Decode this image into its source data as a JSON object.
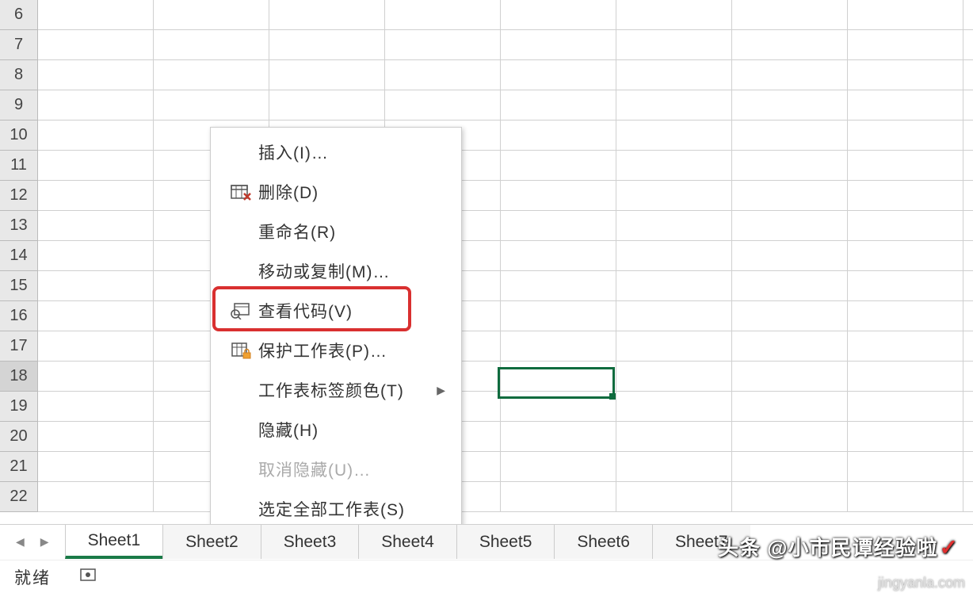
{
  "rows": [
    "6",
    "7",
    "8",
    "9",
    "10",
    "11",
    "12",
    "13",
    "14",
    "15",
    "16",
    "17",
    "18",
    "19",
    "20",
    "21",
    "22"
  ],
  "selected_row_index": 12,
  "menu": {
    "insert": "插入(I)…",
    "delete": "删除(D)",
    "rename": "重命名(R)",
    "move_copy": "移动或复制(M)…",
    "view_code": "查看代码(V)",
    "protect": "保护工作表(P)…",
    "tab_color": "工作表标签颜色(T)",
    "hide": "隐藏(H)",
    "unhide": "取消隐藏(U)…",
    "select_all": "选定全部工作表(S)"
  },
  "tabs": [
    "Sheet1",
    "Sheet2",
    "Sheet3",
    "Sheet4",
    "Sheet5",
    "Sheet6",
    "Sheet7"
  ],
  "active_tab_index": 0,
  "status": "就绪",
  "watermark1": "头条 @小市民谭经验啦",
  "watermark2": "jingyanla.com"
}
